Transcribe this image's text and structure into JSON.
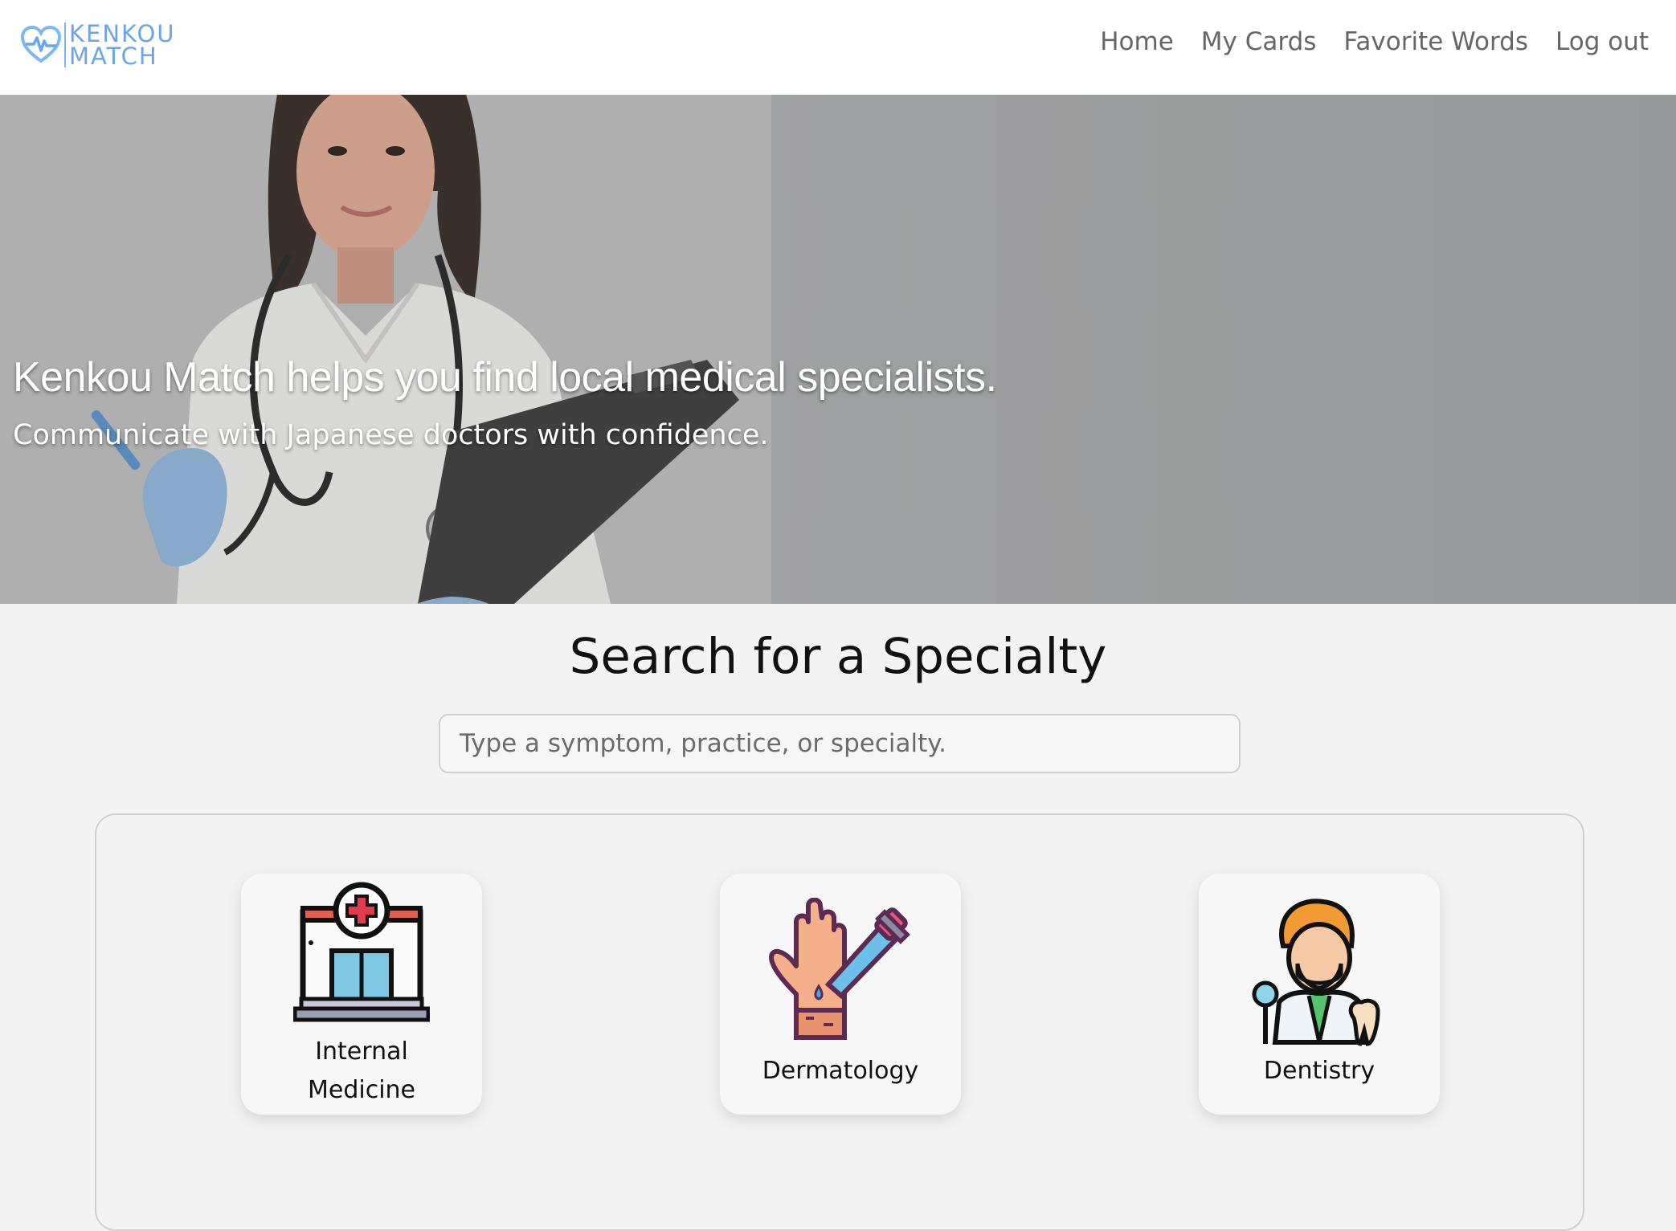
{
  "brand": {
    "line1": "KENKOU",
    "line2": "MATCH",
    "logo_icon": "heart-pulse-icon"
  },
  "nav": {
    "home": "Home",
    "my_cards": "My Cards",
    "favorite_words": "Favorite Words",
    "logout": "Log out"
  },
  "hero": {
    "title": "Kenkou Match helps you find local medical specialists.",
    "subtitle": "Communicate with Japanese doctors with confidence."
  },
  "search": {
    "title": "Search for a Specialty",
    "placeholder": "Type a symptom, practice, or specialty."
  },
  "specialties": [
    {
      "label": "Internal Medicine",
      "line1": "Internal",
      "line2": "Medicine",
      "icon": "hospital-icon"
    },
    {
      "label": "Dermatology",
      "icon": "hand-dropper-icon"
    },
    {
      "label": "Dentistry",
      "icon": "dentist-icon"
    }
  ],
  "colors": {
    "brand": "#6aa5ea",
    "background": "#f3f3f3",
    "navbar": "#ffffff"
  }
}
